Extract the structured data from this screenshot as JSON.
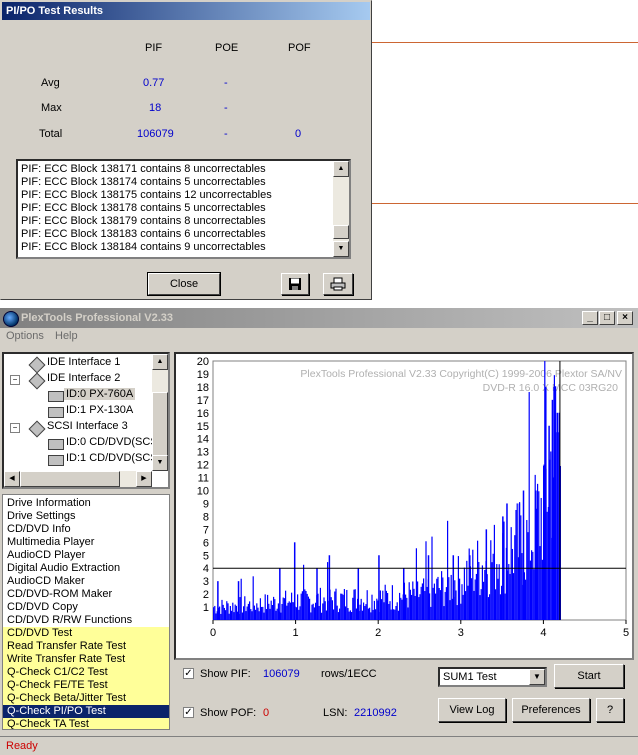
{
  "dialog": {
    "title": "PI/PO Test Results",
    "headers": [
      "PIF",
      "POE",
      "POF"
    ],
    "rows": [
      {
        "label": "Avg",
        "pif": "0.77",
        "poe": "-",
        "pof": ""
      },
      {
        "label": "Max",
        "pif": "18",
        "poe": "-",
        "pof": ""
      },
      {
        "label": "Total",
        "pif": "106079",
        "poe": "-",
        "pof": "0"
      }
    ],
    "log": [
      "PIF: ECC Block 138171 contains 8 uncorrectables",
      "PIF: ECC Block 138174 contains 5 uncorrectables",
      "PIF: ECC Block 138175 contains 12 uncorrectables",
      "PIF: ECC Block 138178 contains 5 uncorrectables",
      "PIF: ECC Block 138179 contains 8 uncorrectables",
      "PIF: ECC Block 138183 contains 6 uncorrectables",
      "PIF: ECC Block 138184 contains 9 uncorrectables"
    ],
    "close_label": "Close"
  },
  "main": {
    "title": "PlexTools Professional V2.33",
    "menu": [
      "Options",
      "Help"
    ],
    "tree": [
      {
        "label": "IDE Interface 1"
      },
      {
        "label": "IDE Interface 2"
      },
      {
        "label": "ID:0  PX-760A"
      },
      {
        "label": "ID:1   PX-130A"
      },
      {
        "label": "SCSI Interface 3"
      },
      {
        "label": "ID:0  CD/DVD(SCS"
      },
      {
        "label": "ID:1  CD/DVD(SCS"
      }
    ],
    "functions": [
      "Drive Information",
      "Drive Settings",
      "CD/DVD Info",
      "Multimedia Player",
      "AudioCD Player",
      "Digital Audio Extraction",
      "AudioCD Maker",
      "CD/DVD-ROM Maker",
      "CD/DVD Copy",
      "CD/DVD R/RW Functions",
      "CD/DVD Test",
      "Read Transfer Rate Test",
      "Write Transfer Rate Test",
      "Q-Check C1/C2 Test",
      "Q-Check FE/TE Test",
      "Q-Check Beta/Jitter Test",
      "Q-Check PI/PO Test",
      "Q-Check TA Test"
    ],
    "controls": {
      "show_pif_label": "Show PIF:",
      "pif_value": "106079",
      "rows_label": "rows/1ECC",
      "sum_select": "SUM1 Test",
      "start_label": "Start",
      "show_pof_label": "Show POF:",
      "pof_value": "0",
      "lsn_label": "LSN:",
      "lsn_value": "2210992",
      "view_log_label": "View Log",
      "preferences_label": "Preferences",
      "help_label": "?"
    },
    "status": "Ready"
  },
  "chart_data": {
    "type": "bar",
    "annotations": [
      "PlexTools Professional V2.33 Copyright(C) 1999-2006 Plextor SA/NV",
      "DVD-R    16.0 X    MCC 03RG20"
    ],
    "x_ticks": [
      "0",
      "1",
      "2",
      "3",
      "4",
      "5"
    ],
    "y_ticks": [
      "1",
      "2",
      "3",
      "4",
      "5",
      "6",
      "7",
      "8",
      "9",
      "10",
      "11",
      "12",
      "13",
      "14",
      "15",
      "16",
      "17",
      "18",
      "19",
      "20"
    ],
    "xlim": [
      0,
      5
    ],
    "ylim": [
      0,
      20
    ],
    "threshold": 4,
    "cursor_x": 4.2,
    "series": [
      {
        "color": "#0000ff",
        "profile": [
          [
            0.0,
            1.0
          ],
          [
            0.5,
            1.2
          ],
          [
            1.0,
            1.5
          ],
          [
            1.5,
            1.6
          ],
          [
            2.0,
            1.7
          ],
          [
            2.5,
            2.0
          ],
          [
            2.8,
            2.6
          ],
          [
            3.0,
            3.2
          ],
          [
            3.3,
            4.5
          ],
          [
            3.6,
            5.5
          ],
          [
            3.8,
            6.0
          ],
          [
            3.95,
            8.0
          ],
          [
            4.05,
            11.0
          ],
          [
            4.15,
            14.0
          ],
          [
            4.2,
            14.0
          ]
        ],
        "spikes": [
          [
            0.05,
            3
          ],
          [
            0.3,
            3
          ],
          [
            0.8,
            4
          ],
          [
            0.98,
            6
          ],
          [
            1.25,
            4
          ],
          [
            1.4,
            5
          ],
          [
            1.75,
            4
          ],
          [
            2.0,
            5
          ],
          [
            2.3,
            4
          ],
          [
            2.6,
            5
          ],
          [
            2.9,
            5
          ],
          [
            3.1,
            5
          ],
          [
            3.3,
            7
          ],
          [
            3.5,
            8
          ],
          [
            3.55,
            9
          ],
          [
            3.7,
            9
          ],
          [
            3.75,
            10
          ],
          [
            3.9,
            10
          ],
          [
            4.0,
            12
          ],
          [
            4.02,
            18
          ],
          [
            4.06,
            15
          ],
          [
            4.1,
            17
          ],
          [
            4.12,
            18
          ],
          [
            4.16,
            16
          ]
        ]
      }
    ]
  }
}
